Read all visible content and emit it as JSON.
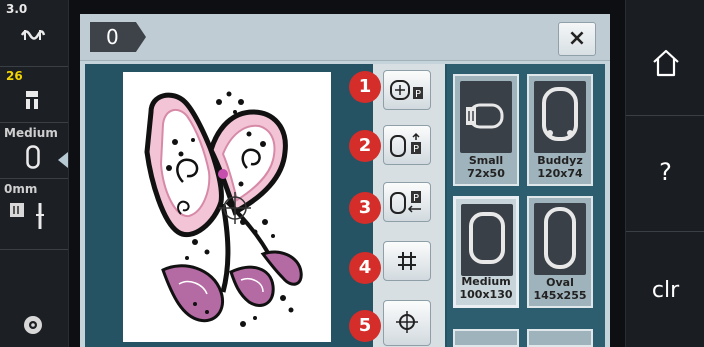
{
  "left_sidebar": {
    "tension": {
      "value": "3.0"
    },
    "stitch": {
      "value": "26"
    },
    "foot": {
      "label": "Medium"
    },
    "needle": {
      "label": "0mm"
    }
  },
  "header": {
    "tab_label": "0",
    "close_label": "×"
  },
  "tools": [
    {
      "badge": "1",
      "icon": "move-hoop-park-icon"
    },
    {
      "badge": "2",
      "icon": "hoop-up-park-icon"
    },
    {
      "badge": "3",
      "icon": "hoop-left-park-icon"
    },
    {
      "badge": "4",
      "icon": "grid-icon"
    },
    {
      "badge": "5",
      "icon": "center-crosshair-icon"
    }
  ],
  "hoops": [
    {
      "name": "Small",
      "size": "72x50",
      "selected": false
    },
    {
      "name": "Buddyz",
      "size": "120x74",
      "selected": false
    },
    {
      "name": "Medium",
      "size": "100x130",
      "selected": true
    },
    {
      "name": "Oval",
      "size": "145x255",
      "selected": false
    }
  ],
  "right_sidebar": {
    "home_icon": "home-icon",
    "help_label": "?",
    "clear_label": "clr"
  },
  "colors": {
    "accent_badge": "#d42d2a",
    "workarea_bg": "#255363",
    "hoop_panel_bg": "#2c5e6f",
    "title_bg": "#c0ccd3"
  }
}
